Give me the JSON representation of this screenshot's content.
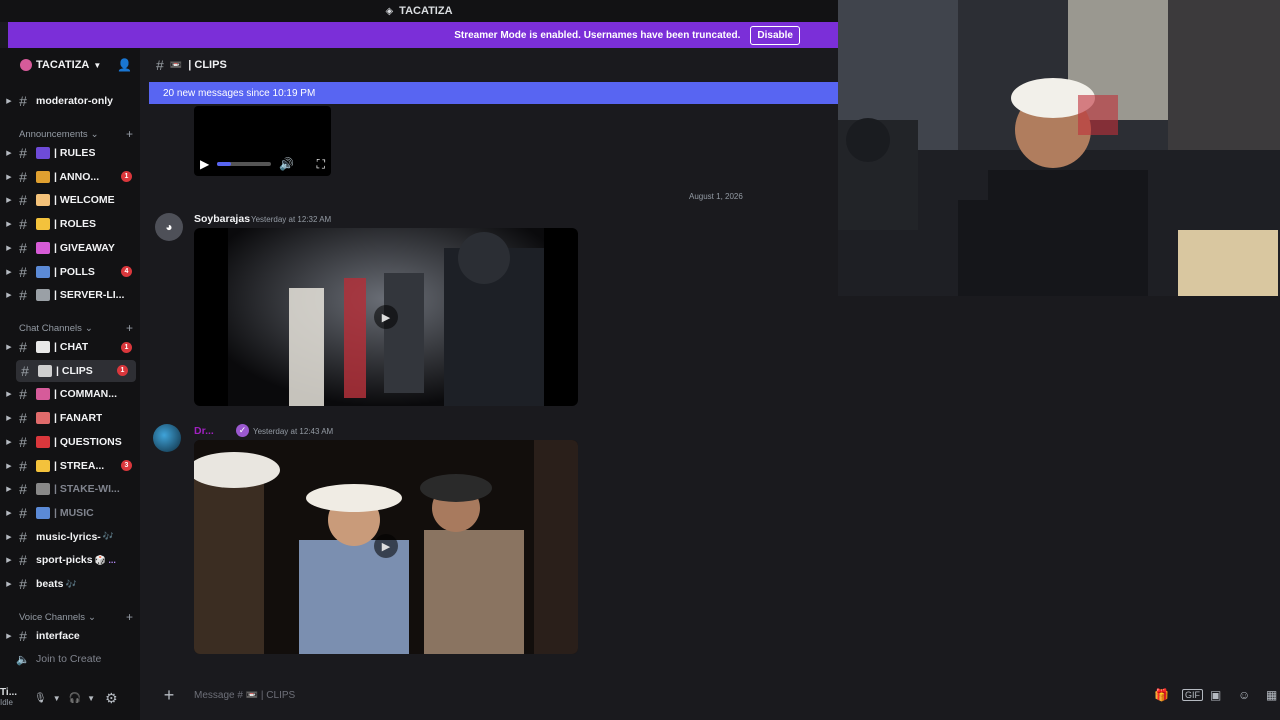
{
  "title_bar": {
    "server_name": "TACATIZA"
  },
  "streamer_banner": {
    "text": "Streamer Mode is enabled. Usernames have been truncated.",
    "button": "Disable"
  },
  "server": {
    "name": "TACATIZA"
  },
  "channels_top": [
    {
      "name": "moderator-only"
    }
  ],
  "categories": {
    "announcements": "Announcements",
    "chat": "Chat Channels",
    "voice": "Voice Channels"
  },
  "announcement_channels": [
    {
      "name": "| RULES",
      "icon": "notebook-icon",
      "color": "#6e4bd8"
    },
    {
      "name": "| ANNO...",
      "icon": "megaphone-icon",
      "color": "#e0a030",
      "badge": "1"
    },
    {
      "name": "| WELCOME",
      "icon": "wave-icon",
      "color": "#f4c27a"
    },
    {
      "name": "| ROLES",
      "icon": "folder-icon",
      "color": "#f3c23c"
    },
    {
      "name": "| GIVEAWAY",
      "icon": "party-icon",
      "color": "#d65bd6"
    },
    {
      "name": "| POLLS",
      "icon": "chart-icon",
      "color": "#5b8ad6",
      "badge": "4"
    },
    {
      "name": "| SERVER-LI...",
      "icon": "link-icon",
      "color": "#9aa0a6"
    }
  ],
  "chat_channels": [
    {
      "name": "| CHAT",
      "icon": "speech-icon",
      "color": "#e8e8e8",
      "badge": "1"
    },
    {
      "name": "| CLIPS",
      "icon": "film-icon",
      "color": "#cfcfcf",
      "badge": "1",
      "active": true
    },
    {
      "name": "| COMMAN...",
      "icon": "robot-icon",
      "color": "#d65b9a"
    },
    {
      "name": "| FANART",
      "icon": "palette-icon",
      "color": "#e06b6b"
    },
    {
      "name": "| QUESTIONS",
      "icon": "question-icon",
      "color": "#da373c"
    },
    {
      "name": "| STREA...",
      "icon": "bulb-icon",
      "color": "#f3c23c",
      "badge": "3"
    },
    {
      "name": "| STAKE-WI...",
      "icon": "slot-icon",
      "color": "#888",
      "muted": true
    },
    {
      "name": "| MUSIC",
      "icon": "note-icon",
      "color": "#5b8ad6",
      "muted": true
    },
    {
      "name": "music-lyrics-",
      "suffix": "🎶"
    },
    {
      "name": "sport-picks",
      "suffix": "🎲 ..."
    },
    {
      "name": "beats",
      "suffix": "🎶"
    }
  ],
  "voice_channels": [
    {
      "name": "interface"
    },
    {
      "name": "Join to Create"
    }
  ],
  "user_bar": {
    "name": "Ti...",
    "status": "Idle"
  },
  "chat_header": {
    "channel": "| CLIPS"
  },
  "new_messages_bar": "20 new messages since 10:19 PM",
  "date_separator": "August 1, 2026",
  "messages": [
    {
      "author": "Soybarajas",
      "time": "Yesterday at 12:32 AM"
    },
    {
      "author": "Dr...",
      "time": "Yesterday at 12:43 AM"
    }
  ],
  "message_input": {
    "placeholder": "Message # 📼 | CLIPS"
  },
  "colors": {
    "accent": "#5865f2",
    "banner": "#7b2fd8",
    "badge": "#da373c"
  }
}
